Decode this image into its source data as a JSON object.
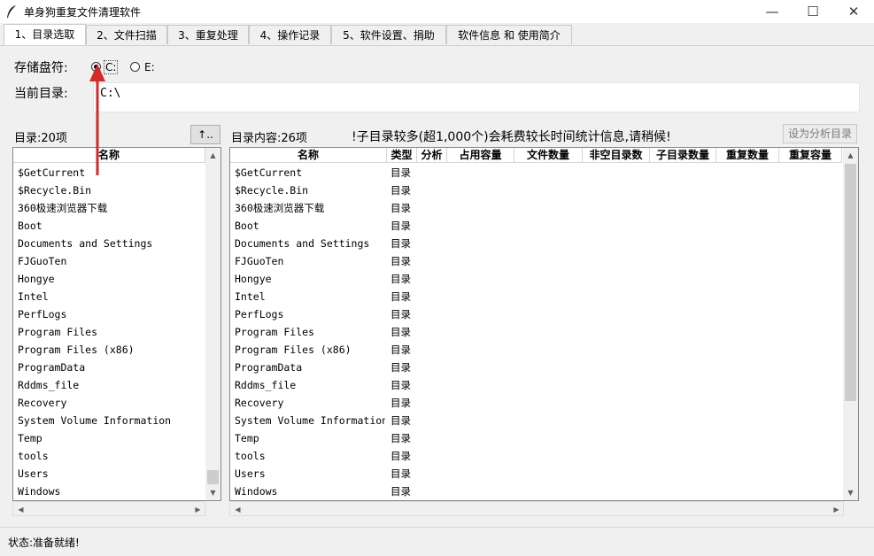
{
  "window": {
    "title": "单身狗重复文件清理软件",
    "controls": {
      "minimize": "—",
      "maximize": "☐",
      "close": "✕"
    }
  },
  "tabs": [
    {
      "label": "1、目录选取",
      "active": true
    },
    {
      "label": "2、文件扫描",
      "active": false
    },
    {
      "label": "3、重复处理",
      "active": false
    },
    {
      "label": "4、操作记录",
      "active": false
    },
    {
      "label": "5、软件设置、捐助",
      "active": false
    },
    {
      "label": "软件信息 和 使用简介",
      "active": false
    }
  ],
  "drive": {
    "label": "存储盘符:",
    "options": [
      {
        "label": "C:",
        "selected": true
      },
      {
        "label": "E:",
        "selected": false
      }
    ]
  },
  "current_dir": {
    "label": "当前目录:",
    "value": "C:\\"
  },
  "left_panel": {
    "count_label": "目录:20项",
    "up_button": "↑..",
    "header": "名称",
    "items": [
      "$GetCurrent",
      "$Recycle.Bin",
      "360极速浏览器下载",
      "Boot",
      "Documents and Settings",
      "FJGuoTen",
      "Hongye",
      "Intel",
      "PerfLogs",
      "Program Files",
      "Program Files (x86)",
      "ProgramData",
      "Rddms_file",
      "Recovery",
      "System Volume Information",
      "Temp",
      "tools",
      "Users",
      "Windows"
    ]
  },
  "right_panel": {
    "count_label": "目录内容:26项",
    "warning": "!子目录较多(超1,000个)会耗费较长时间统计信息,请稍候!",
    "set_button": "设为分析目录",
    "headers": [
      "名称",
      "类型",
      "分析",
      "占用容量",
      "文件数量",
      "非空目录数",
      "子目录数量",
      "重复数量",
      "重复容量"
    ],
    "rows": [
      {
        "name": "$GetCurrent",
        "type": "目录"
      },
      {
        "name": "$Recycle.Bin",
        "type": "目录"
      },
      {
        "name": "360极速浏览器下载",
        "type": "目录"
      },
      {
        "name": "Boot",
        "type": "目录"
      },
      {
        "name": "Documents and Settings",
        "type": "目录"
      },
      {
        "name": "FJGuoTen",
        "type": "目录"
      },
      {
        "name": "Hongye",
        "type": "目录"
      },
      {
        "name": "Intel",
        "type": "目录"
      },
      {
        "name": "PerfLogs",
        "type": "目录"
      },
      {
        "name": "Program Files",
        "type": "目录"
      },
      {
        "name": "Program Files (x86)",
        "type": "目录"
      },
      {
        "name": "ProgramData",
        "type": "目录"
      },
      {
        "name": "Rddms_file",
        "type": "目录"
      },
      {
        "name": "Recovery",
        "type": "目录"
      },
      {
        "name": "System Volume Information",
        "type": "目录"
      },
      {
        "name": "Temp",
        "type": "目录"
      },
      {
        "name": "tools",
        "type": "目录"
      },
      {
        "name": "Users",
        "type": "目录"
      },
      {
        "name": "Windows",
        "type": "目录"
      }
    ]
  },
  "status": {
    "text": "状态:准备就绪!"
  },
  "colors": {
    "annotation_arrow": "#d42a2a",
    "background": "#f0f0f0"
  }
}
